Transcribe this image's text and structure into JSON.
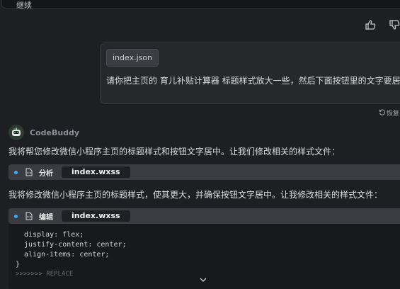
{
  "top_card": {
    "continue_label": "继续"
  },
  "feedback": {
    "like_icon": "thumbs-up-icon",
    "dislike_icon": "thumbs-down-icon"
  },
  "user_message": {
    "file_chip": "index.json",
    "text": "请你把主页的 育儿补贴计算器 标题样式放大一些，然后下面按钮里的文字要居中",
    "restore_label": "恢复"
  },
  "assistant": {
    "name": "CodeBuddy",
    "message_1": "我将帮您修改微信小程序主页的标题样式和按钮文字居中。让我们修改相关的样式文件：",
    "tool_1": {
      "action": "分析",
      "file": "index.wxss",
      "icon": "code-file-icon"
    },
    "message_2": "我将修改微信小程序主页的标题样式，使其更大，并确保按钮文字居中。让我修改相关的样式文件：",
    "tool_2": {
      "action": "编辑",
      "file": "index.wxss",
      "icon": "code-file-icon"
    },
    "code_lines": [
      "  display: flex;",
      "  justify-content: center;",
      "  align-items: center;",
      "}"
    ],
    "replace_marker": ">>>>>>> REPLACE"
  },
  "colors": {
    "background": "#1e1f22",
    "bullet": "#3fa9f5",
    "tool_bar": "#3a3c41"
  }
}
